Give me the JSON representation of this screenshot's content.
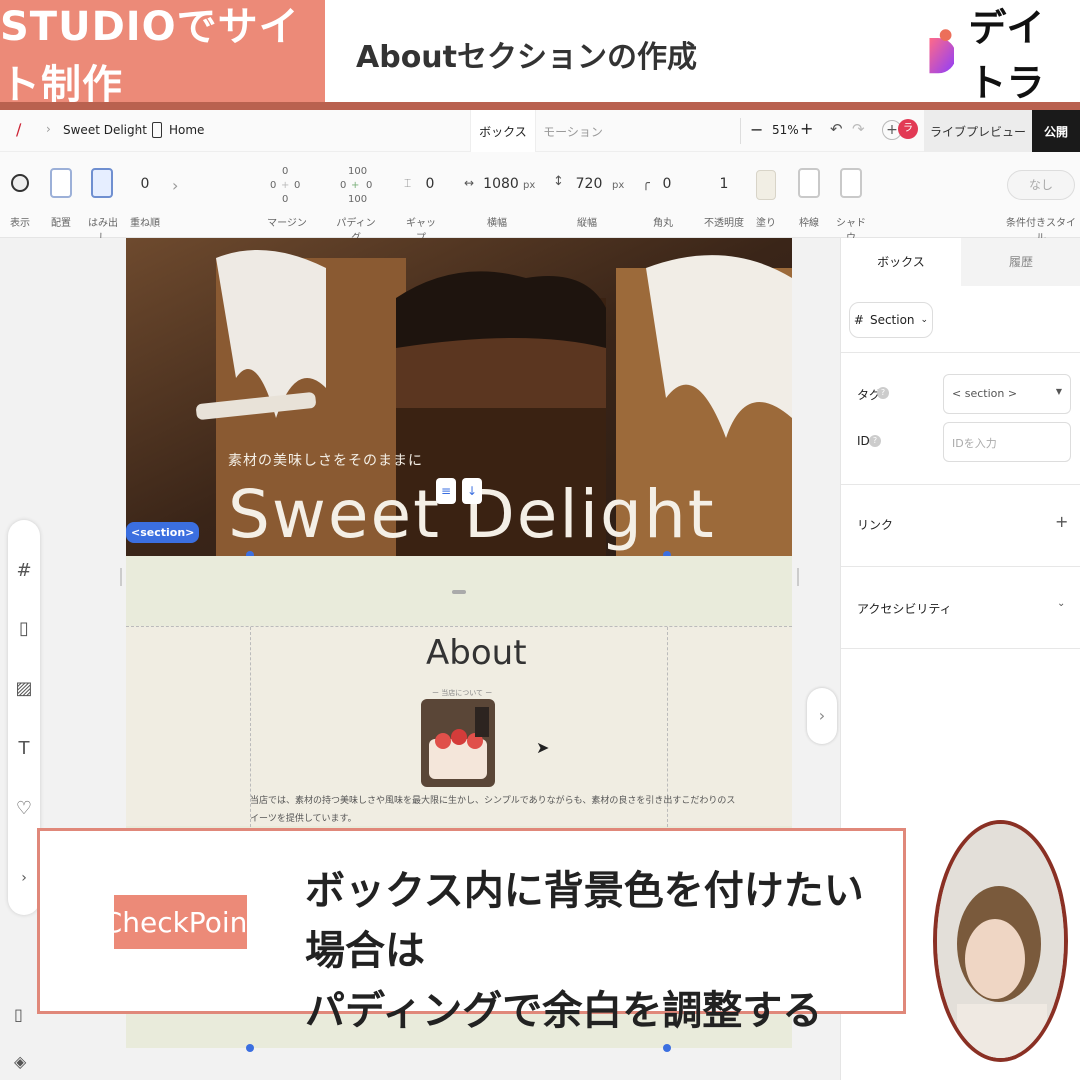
{
  "banner": {
    "tag": "STUDIOでサイト制作",
    "title": "Aboutセクションの作成",
    "brand": "デイトラ"
  },
  "topbar": {
    "crumb_site": "Sweet Delight",
    "crumb_page": "Home",
    "tab_box": "ボックス",
    "tab_motion": "モーション",
    "zoom": "51%",
    "preview": "ライブプレビュー",
    "publish": "公開",
    "avatar_letter": "ラ"
  },
  "props": {
    "show": "表示",
    "place": "配置",
    "overflow": "はみ出し",
    "order_value": "0",
    "order": "重ね順",
    "margin_top": "0",
    "margin_mid": "0",
    "margin_bottom": "0",
    "margin": "マージン",
    "padding_top": "100",
    "padding_left": "0",
    "padding_right": "0",
    "padding_bottom": "100",
    "padding": "パディング",
    "gap_value": "0",
    "gap": "ギャップ",
    "width_value": "1080",
    "width_unit": "px",
    "width": "横幅",
    "height_value": "720",
    "height_unit": "px",
    "height": "縦幅",
    "radius_value": "0",
    "radius": "角丸",
    "opacity_value": "1",
    "opacity": "不透明度",
    "fill": "塗り",
    "border": "枠線",
    "shadow": "シャドウ",
    "cond_value": "なし",
    "cond": "条件付きスタイル"
  },
  "canvas": {
    "hero_sub": "素材の美味しさをそのままに",
    "hero_title": "Sweet Delight",
    "section_badge": "<section>",
    "about_title": "About",
    "about_sub": "ー 当店について ー",
    "about_text_1": "当店では、素材の持つ美味しさや風味を最大限に生かし、シンプルでありながらも、素材の良さを引き出すこだわりのス",
    "about_text_2": "イーツを提供しています。"
  },
  "panel": {
    "tab_box": "ボックス",
    "tab_history": "履歴",
    "element": "Section",
    "tag_label": "タグ",
    "tag_value": "< section >",
    "id_label": "ID",
    "id_placeholder": "IDを入力",
    "link": "リンク",
    "accessibility": "アクセシビリティ"
  },
  "checkpoint": {
    "label": "CheckPoint",
    "line1": "ボックス内に背景色を付けたい場合は",
    "line2": "パディングで余白を調整する"
  },
  "colors": {
    "accent": "#ec8a78",
    "accent_dark": "#b9614f",
    "badge_blue": "#3b6fe0",
    "beige": "#e9ebdb"
  }
}
